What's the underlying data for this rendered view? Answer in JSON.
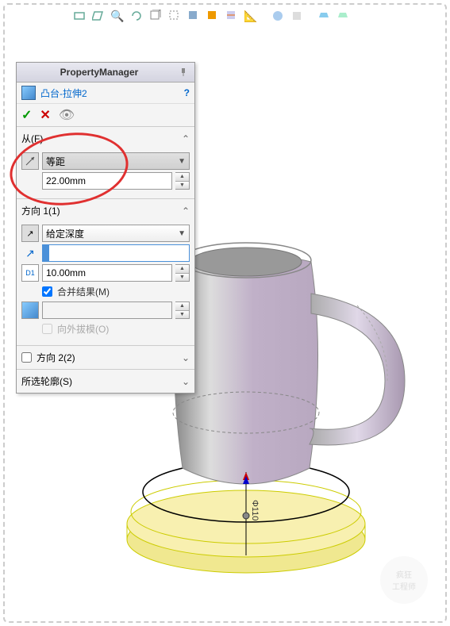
{
  "pm": {
    "title": "PropertyManager",
    "feature_name": "凸台-拉伸2",
    "help": "?"
  },
  "from_section": {
    "label": "从(F)",
    "condition": "等距",
    "offset": "22.00mm"
  },
  "dir1_section": {
    "label": "方向 1(1)",
    "end_condition": "给定深度",
    "depth": "10.00mm",
    "merge_label": "合并结果(M)",
    "merge_checked": true,
    "draft_label": "向外拔模(O)",
    "draft_checked": false
  },
  "dir2_section": {
    "label": "方向 2(2)",
    "checked": false
  },
  "contours_section": {
    "label": "所选轮廓(S)"
  },
  "icons": {
    "ok": "✓",
    "cancel": "✕",
    "preview": "👁",
    "chevron_up": "⌃",
    "chevron_down": "⌄",
    "spinner_up": "▲",
    "spinner_down": "▼",
    "dropdown": "▼",
    "reverse": "↗",
    "dim": "D1"
  },
  "watermark": {
    "line1": "疯狂",
    "line2": "工程师"
  }
}
